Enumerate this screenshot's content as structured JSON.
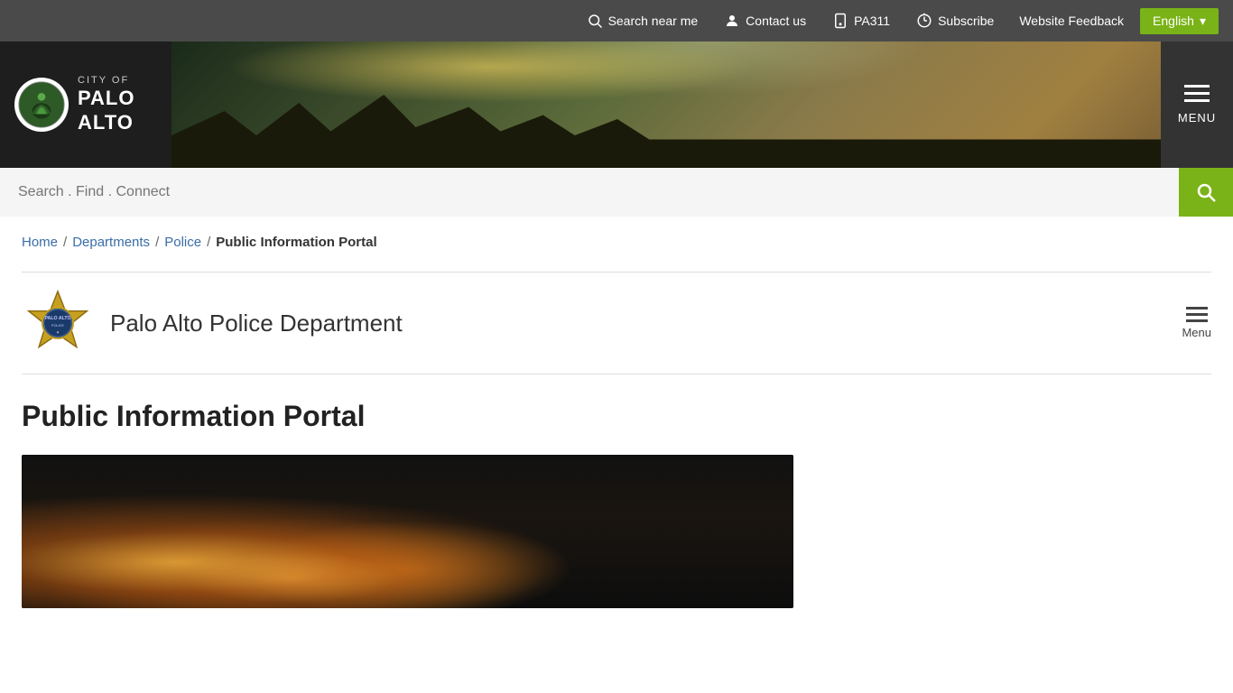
{
  "utility_bar": {
    "search_near_me": "Search near me",
    "contact_us": "Contact us",
    "pa311": "PA311",
    "subscribe": "Subscribe",
    "website_feedback": "Website Feedback",
    "language": "English"
  },
  "header": {
    "city_of": "CITY OF",
    "palo_alto": "PALO ALTO",
    "menu_label": "MENU"
  },
  "search": {
    "placeholder": "Search . Find . Connect"
  },
  "breadcrumb": {
    "home": "Home",
    "departments": "Departments",
    "police": "Police",
    "current": "Public Information Portal"
  },
  "department": {
    "name": "Palo Alto Police Department",
    "menu_label": "Menu"
  },
  "page": {
    "title": "Public Information Portal"
  }
}
